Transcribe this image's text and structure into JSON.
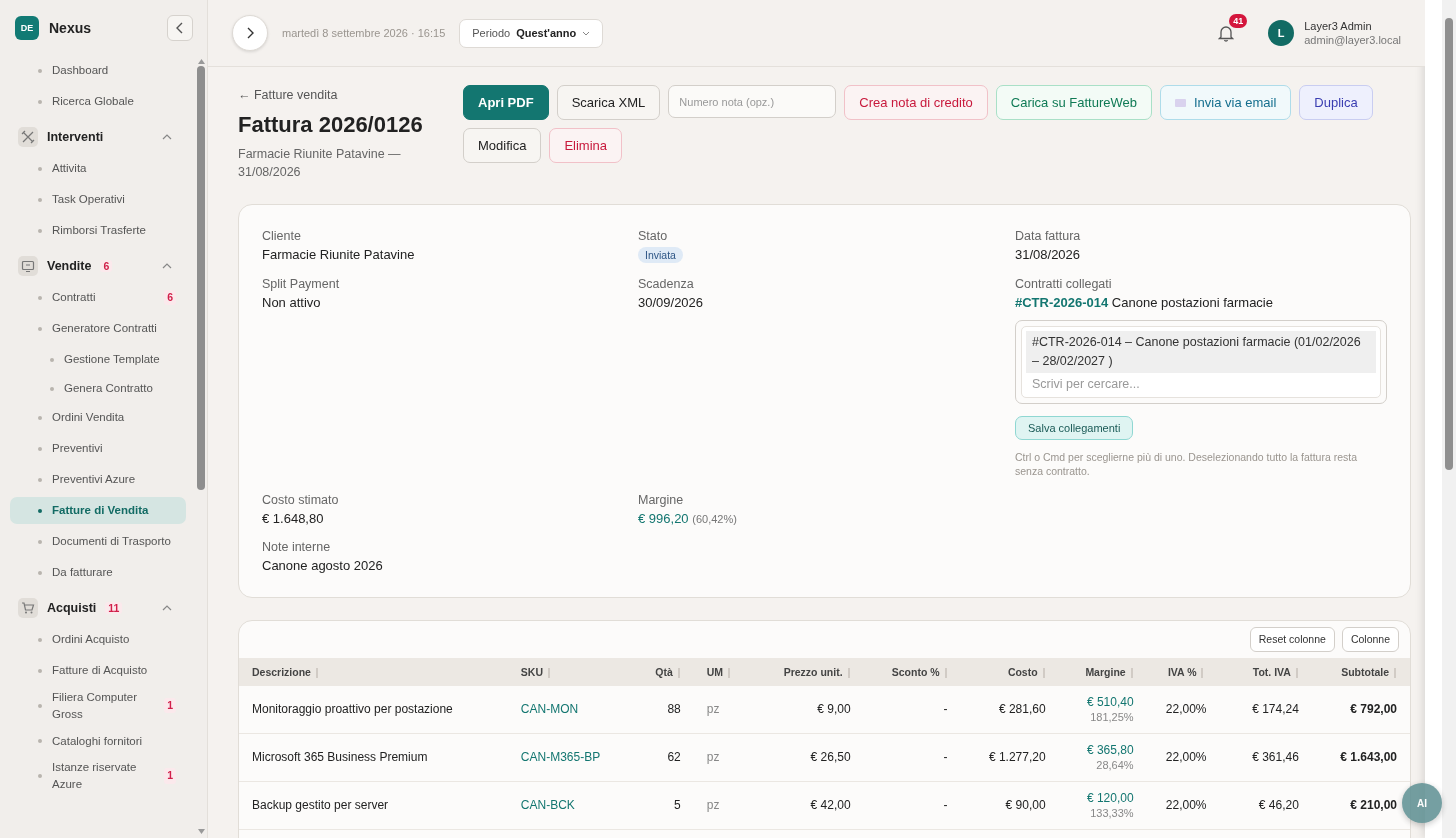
{
  "sidebar": {
    "logo": "DE",
    "brand": "Nexus",
    "items": [
      {
        "kind": "link",
        "label": "Dashboard",
        "selected": false
      },
      {
        "kind": "link",
        "label": "Ricerca Globale",
        "selected": false
      },
      {
        "kind": "section",
        "label": "Interventi",
        "expanded": true,
        "children": [
          {
            "kind": "link",
            "label": "Attivita",
            "selected": false
          },
          {
            "kind": "link",
            "label": "Task Operativi",
            "selected": false
          },
          {
            "kind": "link",
            "label": "Rimborsi Trasferte",
            "selected": false
          }
        ]
      },
      {
        "kind": "section",
        "label": "Vendite",
        "badge": "6",
        "expanded": true,
        "children": [
          {
            "kind": "link",
            "label": "Contratti",
            "badge": "6",
            "selected": false
          },
          {
            "kind": "link",
            "label": "Generatore Contratti",
            "selected": false,
            "children": [
              {
                "kind": "link",
                "label": "Gestione Template",
                "selected": false
              },
              {
                "kind": "link",
                "label": "Genera Contratto",
                "selected": false
              }
            ]
          },
          {
            "kind": "link",
            "label": "Ordini Vendita",
            "selected": false
          },
          {
            "kind": "link",
            "label": "Preventivi",
            "selected": false
          },
          {
            "kind": "link",
            "label": "Preventivi Azure",
            "selected": false
          },
          {
            "kind": "link",
            "label": "Fatture di Vendita",
            "selected": true
          },
          {
            "kind": "link",
            "label": "Documenti di Trasporto",
            "selected": false
          },
          {
            "kind": "link",
            "label": "Da fatturare",
            "selected": false
          }
        ]
      },
      {
        "kind": "section",
        "label": "Acquisti",
        "badge": "11",
        "expanded": true,
        "children": [
          {
            "kind": "link",
            "label": "Ordini Acquisto",
            "selected": false
          },
          {
            "kind": "link",
            "label": "Fatture di Acquisto",
            "selected": false
          },
          {
            "kind": "link",
            "label": "Filiera Computer Gross",
            "badge": "1",
            "selected": false
          },
          {
            "kind": "link",
            "label": "Cataloghi fornitori",
            "selected": false
          },
          {
            "kind": "link",
            "label": "Istanze riservate Azure",
            "badge": "1",
            "selected": false
          }
        ]
      }
    ]
  },
  "topbar": {
    "date": "martedì 8 settembre 2026 · 16:15",
    "period_label": "Periodo",
    "period_value": "Quest'anno",
    "notifications": "41",
    "avatar": "L",
    "user_name": "Layer3 Admin",
    "user_email": "admin@layer3.local"
  },
  "page": {
    "back": "← Fatture vendita",
    "title": "Fattura 2026/0126",
    "subtitle": "Farmacie Riunite Patavine — 31/08/2026",
    "actions": [
      {
        "kind": "primary",
        "label": "Apri PDF"
      },
      {
        "kind": "neutral",
        "label": "Scarica XML"
      },
      {
        "kind": "input",
        "placeholder": "Numero nota (opz.)"
      },
      {
        "kind": "danger",
        "label": "Crea nota di credito"
      },
      {
        "kind": "success",
        "label": "Carica su FattureWeb"
      },
      {
        "kind": "info",
        "label": "Invia via email",
        "icon": true
      },
      {
        "kind": "accent",
        "label": "Duplica"
      },
      {
        "kind": "neutral",
        "label": "Modifica"
      },
      {
        "kind": "danger",
        "label": "Elimina"
      }
    ]
  },
  "details": {
    "cliente": {
      "label": "Cliente",
      "value": "Farmacie Riunite Patavine"
    },
    "stato": {
      "label": "Stato",
      "value": "Inviata"
    },
    "data": {
      "label": "Data fattura",
      "value": "31/08/2026"
    },
    "split": {
      "label": "Split Payment",
      "value": "Non attivo"
    },
    "scadenza": {
      "label": "Scadenza",
      "value": "30/09/2026"
    },
    "contratti": {
      "label": "Contratti collegati",
      "code": "#CTR-2026-014",
      "name": "Canone postazioni farmacie",
      "options": [
        {
          "label": "#CTR-2026-014 – Canone postazioni farmacie (01/02/2026 – 28/02/2027 )",
          "selected": true
        }
      ],
      "search_placeholder": "Scrivi per cercare...",
      "save": "Salva collegamenti",
      "hint": "Ctrl o Cmd per sceglierne più di uno. Deselezionando tutto la fattura resta senza contratto."
    },
    "costo": {
      "label": "Costo stimato",
      "value": "€ 1.648,80"
    },
    "margine": {
      "label": "Margine",
      "value": "€ 996,20",
      "percent": "(60,42%)"
    },
    "note": {
      "label": "Note interne",
      "value": "Canone agosto 2026"
    }
  },
  "table": {
    "reset": "Reset colonne",
    "columns_button": "Colonne",
    "columns": [
      {
        "label": "Descrizione"
      },
      {
        "label": "SKU"
      },
      {
        "label": "Qtà"
      },
      {
        "label": "UM"
      },
      {
        "label": "Prezzo unit."
      },
      {
        "label": "Sconto %"
      },
      {
        "label": "Costo"
      },
      {
        "label": "Margine"
      },
      {
        "label": "IVA %"
      },
      {
        "label": "Tot. IVA"
      },
      {
        "label": "Subtotale"
      }
    ],
    "rows": [
      {
        "descrizione": "Monitoraggio proattivo per postazione",
        "sku": "CAN-MON",
        "qta": "88",
        "um": "pz",
        "prezzo": "€ 9,00",
        "sconto": "-",
        "costo": "€ 281,60",
        "margine": "€ 510,40",
        "margine_pct": "181,25%",
        "iva": "22,00%",
        "tot_iva": "€ 174,24",
        "subtotale": "€ 792,00"
      },
      {
        "descrizione": "Microsoft 365 Business Premium",
        "sku": "CAN-M365-BP",
        "qta": "62",
        "um": "pz",
        "prezzo": "€ 26,50",
        "sconto": "-",
        "costo": "€ 1.277,20",
        "margine": "€ 365,80",
        "margine_pct": "28,64%",
        "iva": "22,00%",
        "tot_iva": "€ 361,46",
        "subtotale": "€ 1.643,00"
      },
      {
        "descrizione": "Backup gestito per server",
        "sku": "CAN-BCK",
        "qta": "5",
        "um": "pz",
        "prezzo": "€ 42,00",
        "sconto": "-",
        "costo": "€ 90,00",
        "margine": "€ 120,00",
        "margine_pct": "133,33%",
        "iva": "22,00%",
        "tot_iva": "€ 46,20",
        "subtotale": "€ 210,00"
      }
    ]
  },
  "assistant": {
    "label": "AI"
  }
}
